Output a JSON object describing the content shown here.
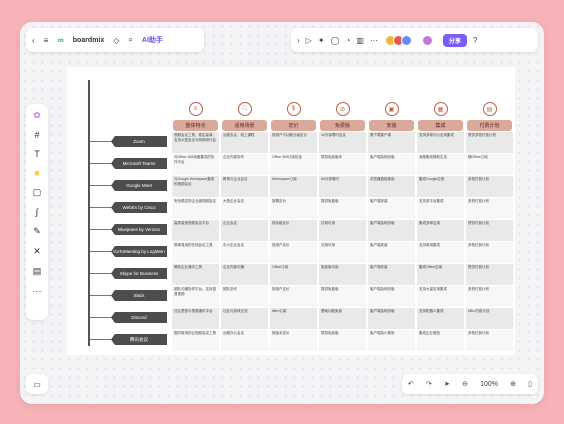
{
  "toolbar": {
    "logo": "boardmix",
    "ai_label": "AI助手",
    "share_label": "分享"
  },
  "zoom": {
    "value": "100%"
  },
  "colors": {
    "accent": "#7b5cff",
    "header": "#d9a99a",
    "row_label": "#4d4d4d"
  },
  "table": {
    "columns": [
      "整体特点",
      "适用场景",
      "定价",
      "免费版",
      "安装",
      "集成",
      "付费计划"
    ],
    "rows": [
      {
        "label": "Zoom",
        "cells": [
          "视频会议工具，稳定高清，支持大型会议与网络研讨会",
          "远程会议、线上课程",
          "按用户与功能分级定价",
          "40分钟限时会议",
          "需下载客户端",
          "支持多种办公应用集成",
          "提供多档付费计划"
        ]
      },
      {
        "label": "Microsoft Teams",
        "cells": [
          "与Office 365深度集成的协作平台",
          "企业内部协作",
          "Office 365订阅包含",
          "提供免费版本",
          "客户端及网页版",
          "深度集成微软生态",
          "随Office订阅"
        ]
      },
      {
        "label": "Google Meet",
        "cells": [
          "与Google Workspace集成的视频会议",
          "教育与企业会议",
          "Workspace订阅",
          "60分钟限时",
          "浏览器直接使用",
          "集成Google应用",
          "多档付费计划"
        ]
      },
      {
        "label": "WebEx by Cisco",
        "cells": [
          "安全稳定的企业级视频会议",
          "大型企业会议",
          "按需定价",
          "提供免费版",
          "客户端安装",
          "支持多平台集成",
          "多档付费计划"
        ]
      },
      {
        "label": "Bluejeans by Verizon",
        "cells": [
          "高质量音视频会议平台",
          "企业会议",
          "按功能定价",
          "试用可用",
          "客户端及网页版",
          "集成多种应用",
          "提供付费计划"
        ]
      },
      {
        "label": "GoToMeeting by LogMeIn",
        "cells": [
          "简单易用的在线会议工具",
          "中小企业会议",
          "按用户定价",
          "试用可用",
          "客户端安装",
          "支持常用集成",
          "多档付费计划"
        ]
      },
      {
        "label": "Skype for Business",
        "cells": [
          "微软企业通讯工具",
          "企业内部沟通",
          "Office订阅",
          "免费版可用",
          "客户端安装",
          "集成Office应用",
          "提供付费计划"
        ]
      },
      {
        "label": "Slack",
        "cells": [
          "团队沟通协作平台，支持语音视频",
          "团队协作",
          "按用户定价",
          "提供免费版",
          "客户端及网页版",
          "支持大量应用集成",
          "多档付费计划"
        ]
      },
      {
        "label": "Discord",
        "cells": [
          "社区语音与视频通讯平台",
          "社区与游戏交流",
          "Nitro订阅",
          "基础功能免费",
          "客户端及网页版",
          "支持机器人集成",
          "Nitro付费计划"
        ]
      },
      {
        "label": "腾讯会议",
        "cells": [
          "国内常用的云视频会议工具",
          "远程办公会议",
          "按版本定价",
          "提供免费版",
          "客户端及小程序",
          "集成企业微信",
          "多档付费计划"
        ]
      }
    ]
  }
}
